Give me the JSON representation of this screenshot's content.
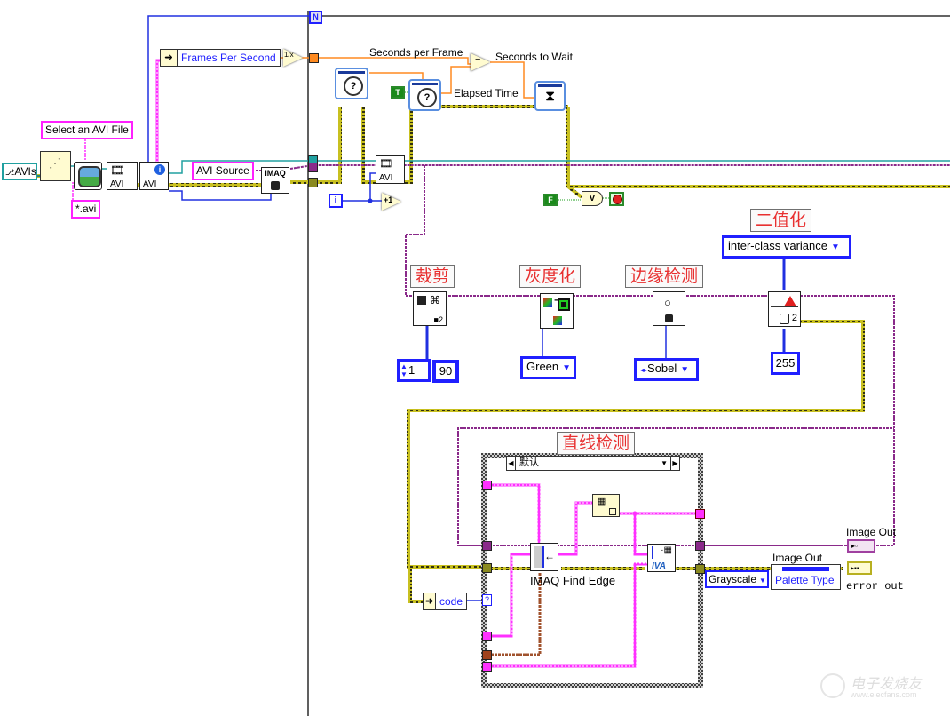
{
  "diagram": {
    "type": "labview-block-diagram",
    "left_section": {
      "avis_constant": "AVIs",
      "select_file_prompt": "Select an AVI File",
      "file_pattern": "*.avi",
      "avi_source_label": "AVI Source",
      "imaq_label": "IMAQ",
      "avi_open_label": "AVI",
      "avi_info_label": "AVI",
      "frames_per_second": "Frames Per Second",
      "reciprocal_glyph": "1/x"
    },
    "while_loop": {
      "iteration_terminal": "i",
      "increment_glyph": "+1",
      "avi_read_label": "AVI",
      "timing": {
        "seconds_per_frame": "Seconds per Frame",
        "seconds_to_wait": "Seconds to Wait",
        "elapsed_time": "Elapsed Time",
        "subtract_glyph": "−",
        "true_constant": "T",
        "false_constant": "F",
        "or_glyph": "V"
      },
      "processing_steps": [
        {
          "label": "裁剪",
          "param": [
            "1",
            "90"
          ]
        },
        {
          "label": "灰度化",
          "param": "Green"
        },
        {
          "label": "边缘检测",
          "param": "Sobel"
        },
        {
          "label": "二值化",
          "method": "inter-class variance",
          "param": "255"
        }
      ],
      "threshold_step_index": "2",
      "case_structure": {
        "title": "直线检测",
        "selector": "默认",
        "find_edge_label": "IMAQ Find Edge",
        "iva_label": "IVA",
        "code_label": "code",
        "selector_terminal": "?"
      },
      "outputs": {
        "image_out_label": "Image Out",
        "image_out_property_title": "Image Out",
        "palette_type_property": "Palette Type",
        "palette_value": "Grayscale",
        "error_out_label": "error out"
      },
      "stop_terminal": "stop",
      "loop_count_terminal": "N"
    },
    "watermark": {
      "title": "电子发烧友",
      "url": "www.elecfans.com"
    },
    "wire_colors": {
      "image": "#ff20ff",
      "imaq_ref": "#8a2a8a",
      "error": "#b8b020",
      "numeric_int": "#2020ff",
      "numeric_dbl": "#ff8a20",
      "boolean": "#20a020",
      "avi_ref": "#20a0a0",
      "cluster": "#8a4a20"
    }
  }
}
